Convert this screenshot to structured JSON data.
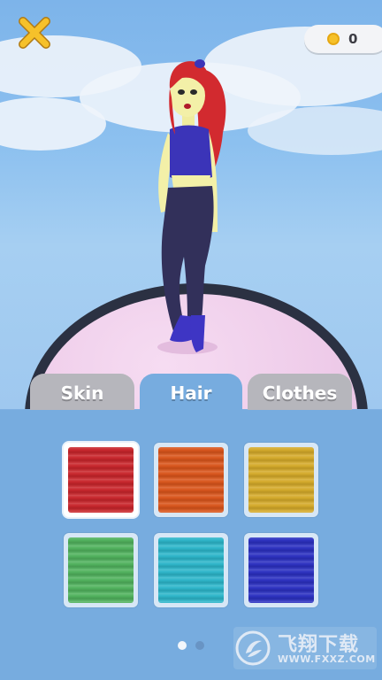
{
  "header": {
    "close_icon": "close-x-icon",
    "coins": {
      "icon": "coin-icon",
      "count": "0"
    }
  },
  "tabs": [
    {
      "label": "Skin",
      "active": false
    },
    {
      "label": "Hair",
      "active": true
    },
    {
      "label": "Clothes",
      "active": false
    }
  ],
  "hair_colors": [
    {
      "name": "red",
      "color": "#c8242a",
      "selected": true
    },
    {
      "name": "orange",
      "color": "#d9541a",
      "selected": false
    },
    {
      "name": "gold",
      "color": "#d4a928",
      "selected": false
    },
    {
      "name": "green",
      "color": "#4fb15c",
      "selected": false
    },
    {
      "name": "cyan",
      "color": "#2bb5c9",
      "selected": false
    },
    {
      "name": "blue",
      "color": "#2a2fc0",
      "selected": false
    }
  ],
  "pagination": {
    "pages": 2,
    "current": 1
  },
  "watermark": {
    "title": "飞翔下载",
    "url": "WWW.FXXZ.COM"
  },
  "colors": {
    "panel": "#77acdf",
    "tab_inactive": "#b6b6bc",
    "platform": "#f2d3ee"
  }
}
